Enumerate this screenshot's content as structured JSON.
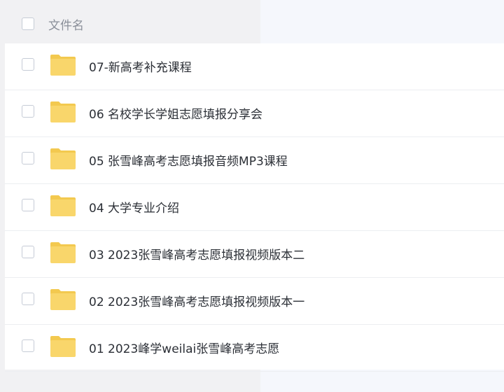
{
  "header": {
    "column_label": "文件名"
  },
  "colors": {
    "folder": "#f9d66b",
    "folder_tab": "#f3c94f",
    "checkbox_border": "#c6ccd6",
    "text": "#2b2f36",
    "header_text": "#8a8f99"
  },
  "files": [
    {
      "name": "07-新高考补充课程",
      "icon": "folder-icon"
    },
    {
      "name": "06 名校学长学姐志愿填报分享会",
      "icon": "folder-icon"
    },
    {
      "name": "05 张雪峰高考志愿填报音频MP3课程",
      "icon": "folder-icon"
    },
    {
      "name": "04 大学专业介绍",
      "icon": "folder-icon"
    },
    {
      "name": "03 2023张雪峰高考志愿填报视频版本二",
      "icon": "folder-icon"
    },
    {
      "name": "02 2023张雪峰高考志愿填报视频版本一",
      "icon": "folder-icon"
    },
    {
      "name": "01 2023峰学weilai张雪峰高考志愿",
      "icon": "folder-icon"
    }
  ]
}
